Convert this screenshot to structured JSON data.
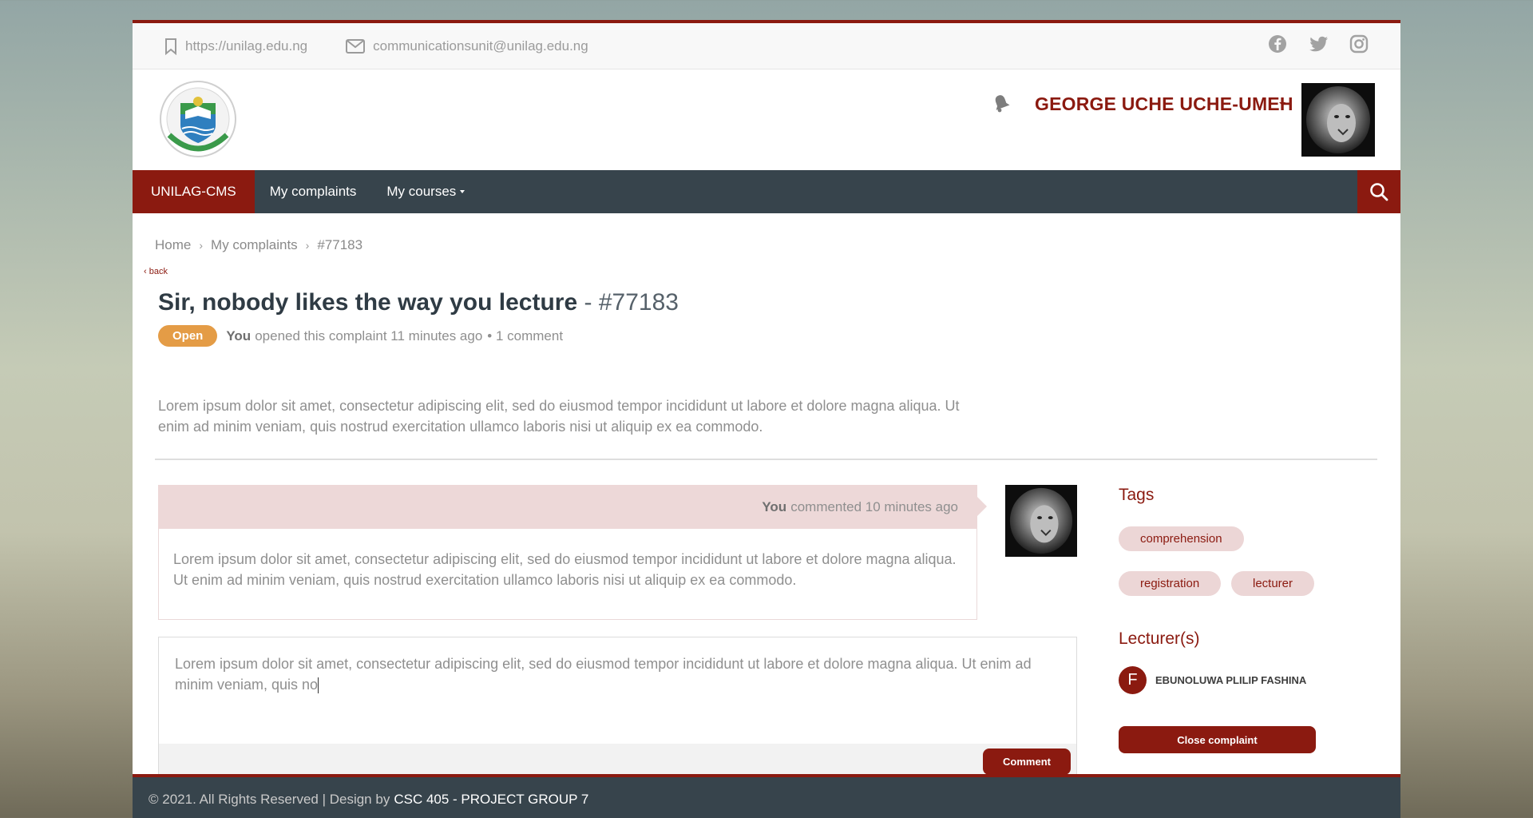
{
  "topbar": {
    "website": "https://unilag.edu.ng",
    "email": "communicationsunit@unilag.edu.ng",
    "socials": [
      "facebook-icon",
      "twitter-icon",
      "instagram-icon"
    ]
  },
  "header": {
    "user_name": "GEORGE UCHE UCHE-UMEH"
  },
  "nav": {
    "brand": "UNILAG-CMS",
    "items": [
      "My complaints",
      "My courses"
    ]
  },
  "breadcrumb": [
    "Home",
    "My complaints",
    "#77183"
  ],
  "back_label": "back",
  "complaint": {
    "title": "Sir, nobody likes the way you lecture",
    "number": " - #77183",
    "status": "Open",
    "author": "You",
    "opened_text": "opened this complaint 11 minutes ago",
    "comment_count": "• 1 comment",
    "description": "Lorem ipsum dolor sit amet, consectetur adipiscing elit, sed do eiusmod tempor incididunt ut labore et dolore magna aliqua. Ut enim ad minim veniam, quis nostrud exercitation ullamco laboris nisi ut aliquip ex ea commodo."
  },
  "comment": {
    "author": "You",
    "meta": "commented 10 minutes ago",
    "body": "Lorem ipsum dolor sit amet, consectetur adipiscing elit, sed do eiusmod tempor incididunt ut labore et dolore magna aliqua. Ut enim ad minim veniam, quis nostrud exercitation ullamco laboris nisi ut aliquip ex ea commodo."
  },
  "editor": {
    "value": "Lorem ipsum dolor sit amet, consectetur adipiscing elit, sed do eiusmod tempor incididunt ut labore et dolore magna aliqua. Ut enim ad minim veniam, quis no",
    "submit_label": "Comment"
  },
  "sidebar": {
    "tags_heading": "Tags",
    "tags": [
      "comprehension",
      "registration",
      "lecturer"
    ],
    "lecturers_heading": "Lecturer(s)",
    "lecturers": [
      {
        "initial": "F",
        "name": "EBUNOLUWA PLILIP FASHINA"
      }
    ],
    "close_label": "Close complaint"
  },
  "footer": {
    "text": "© 2021. All Rights Reserved | Design by",
    "group": "CSC 405 - PROJECT GROUP 7"
  },
  "colors": {
    "brand_red": "#8b1a10",
    "nav_dark": "#37444c",
    "open_badge": "#e49c46",
    "tag_bg": "#ecd6d6"
  }
}
